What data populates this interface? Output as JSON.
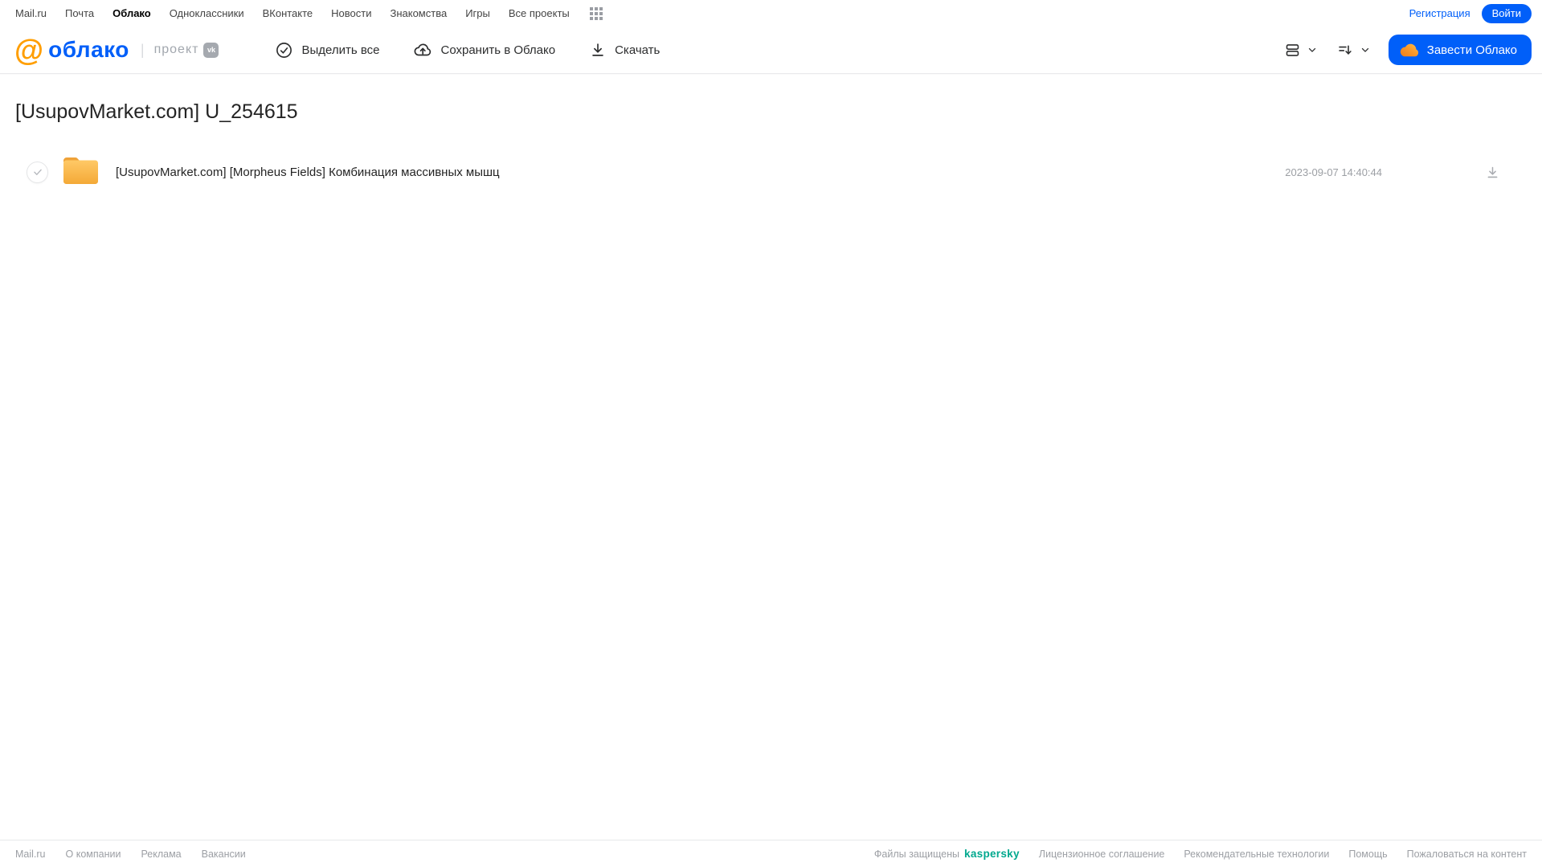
{
  "topnav": {
    "items": [
      {
        "label": "Mail.ru"
      },
      {
        "label": "Почта"
      },
      {
        "label": "Облако"
      },
      {
        "label": "Одноклассники"
      },
      {
        "label": "ВКонтакте"
      },
      {
        "label": "Новости"
      },
      {
        "label": "Знакомства"
      },
      {
        "label": "Игры"
      },
      {
        "label": "Все проекты"
      }
    ],
    "registration_label": "Регистрация",
    "login_label": "Войти"
  },
  "header": {
    "logo": {
      "at": "@",
      "text": "облако",
      "separator": "|",
      "project": "проект",
      "vk_badge": "vk"
    },
    "toolbar": {
      "select_all_label": "Выделить все",
      "save_to_cloud_label": "Сохранить в Облако",
      "download_label": "Скачать"
    },
    "get_cloud_label": "Завести Облако"
  },
  "main": {
    "title": "[UsupovMarket.com] U_254615",
    "files": [
      {
        "name": "[UsupovMarket.com] [Morpheus Fields] Комбинация массивных мышц",
        "date": "2023-09-07 14:40:44",
        "type": "folder"
      }
    ]
  },
  "footer": {
    "left_links": [
      "Mail.ru",
      "О компании",
      "Реклама",
      "Вакансии"
    ],
    "protected_label": "Файлы защищены",
    "kaspersky_label": "kaspersky",
    "right_links": [
      "Лицензионное соглашение",
      "Рекомендательные технологии",
      "Помощь",
      "Пожаловаться на контент"
    ]
  },
  "colors": {
    "accent_blue": "#005ff9",
    "logo_orange": "#ff9e00",
    "folder_orange_top": "#ffc966",
    "folder_orange_bottom": "#f4a937",
    "kaspersky_green": "#00a88e",
    "muted_gray": "#9c9fa4"
  }
}
